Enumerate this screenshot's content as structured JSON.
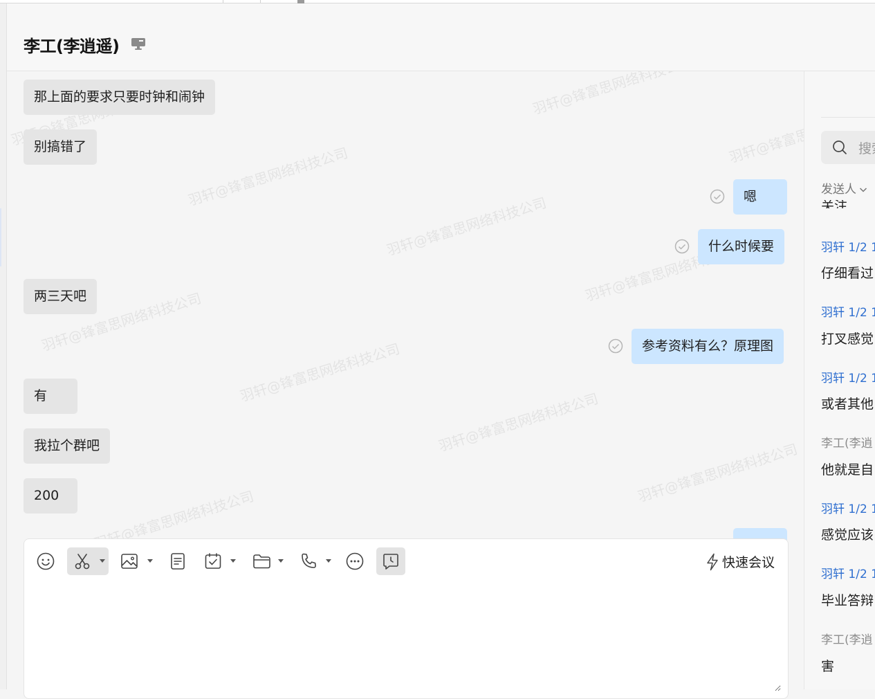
{
  "header": {
    "title": "李工(李逍遥)",
    "device_icon": "desktop-icon"
  },
  "watermark": "羽轩@锋富思网络科技公司",
  "messages": [
    {
      "direction": "in",
      "text": "那上面的要求只要时钟和闹钟"
    },
    {
      "direction": "in",
      "text": "别搞错了"
    },
    {
      "direction": "out",
      "text": "嗯",
      "status_icon": "read-check-icon"
    },
    {
      "direction": "out",
      "text": "什么时候要",
      "status_icon": "read-check-icon"
    },
    {
      "direction": "in",
      "text": "两三天吧"
    },
    {
      "direction": "out",
      "text": "参考资料有么？原理图",
      "status_icon": "read-check-icon"
    },
    {
      "direction": "in",
      "text": "有"
    },
    {
      "direction": "in",
      "text": "我拉个群吧"
    },
    {
      "direction": "in",
      "text": "200"
    }
  ],
  "composer": {
    "toolbar_icons": [
      "emoji-icon",
      "screenshot-scissors-icon",
      "image-icon",
      "document-icon",
      "task-icon",
      "folder-icon",
      "phone-icon",
      "more-icon",
      "chat-history-icon"
    ],
    "quick_meeting_label": "快速会议",
    "quick_meeting_icon": "lightning-icon",
    "input_value": ""
  },
  "right_panel": {
    "search_placeholder": "搜索",
    "filter_label": "发送人",
    "cut_text": "关注…",
    "results": [
      {
        "sender": "羽轩 1/2 1",
        "sender_color": "#2f6fd0",
        "text": "仔细看过"
      },
      {
        "sender": "羽轩 1/2 1",
        "sender_color": "#2f6fd0",
        "text": "打叉感觉"
      },
      {
        "sender": "羽轩 1/2 1",
        "sender_color": "#2f6fd0",
        "text": "或者其他"
      },
      {
        "sender": "李工(李逍",
        "sender_color": "#8c8c8c",
        "text": "他就是自"
      },
      {
        "sender": "羽轩 1/2 1",
        "sender_color": "#2f6fd0",
        "text": "感觉应该"
      },
      {
        "sender": "羽轩 1/2 1",
        "sender_color": "#2f6fd0",
        "text": "毕业答辩"
      },
      {
        "sender": "李工(李逍",
        "sender_color": "#8c8c8c",
        "text": "害"
      }
    ]
  },
  "colors": {
    "incoming_bubble": "#e5e5e5",
    "outgoing_bubble": "#cce6ff",
    "sender_blue": "#2f6fd0",
    "background": "#f5f5f5"
  }
}
